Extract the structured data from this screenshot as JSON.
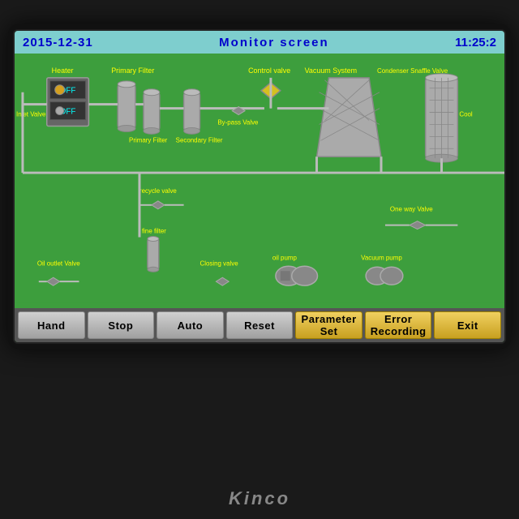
{
  "header": {
    "date": "2015-12-31",
    "title": "Monitor screen",
    "time": "11:25:2"
  },
  "buttons": [
    {
      "label": "Hand",
      "style": "gray",
      "name": "hand-button"
    },
    {
      "label": "Stop",
      "style": "gray",
      "name": "stop-button"
    },
    {
      "label": "Auto",
      "style": "gray",
      "name": "auto-button"
    },
    {
      "label": "Reset",
      "style": "gray",
      "name": "reset-button"
    },
    {
      "label": "Parameter Set",
      "style": "yellow",
      "name": "parameter-set-button"
    },
    {
      "label": "Error Recording",
      "style": "yellow",
      "name": "error-recording-button"
    },
    {
      "label": "Exit",
      "style": "yellow",
      "name": "exit-button"
    }
  ],
  "brand": "Kinco",
  "diagram": {
    "labels": {
      "heater": "Heater",
      "primaryFilter": "Primary Filter",
      "controlValve": "Control valve",
      "vacuumSystem": "Vacuum System",
      "condenser": "Condenser Snaffle Valve",
      "inletValve": "Inlet Valve",
      "secondaryFilter": "Secondary Filter",
      "bypassValve": "By-pass Valve",
      "recycleValve": "recycle valve",
      "fineFiler": "fine filter",
      "oilOutletValve": "Oil outlet Valve",
      "closingValve": "Closing valve",
      "oilPump": "oil pump",
      "vacuumPump": "Vacuum pump",
      "oneWayValve": "One way Valve",
      "cool": "Cool",
      "off1": "OFF",
      "off2": "OFF"
    }
  }
}
